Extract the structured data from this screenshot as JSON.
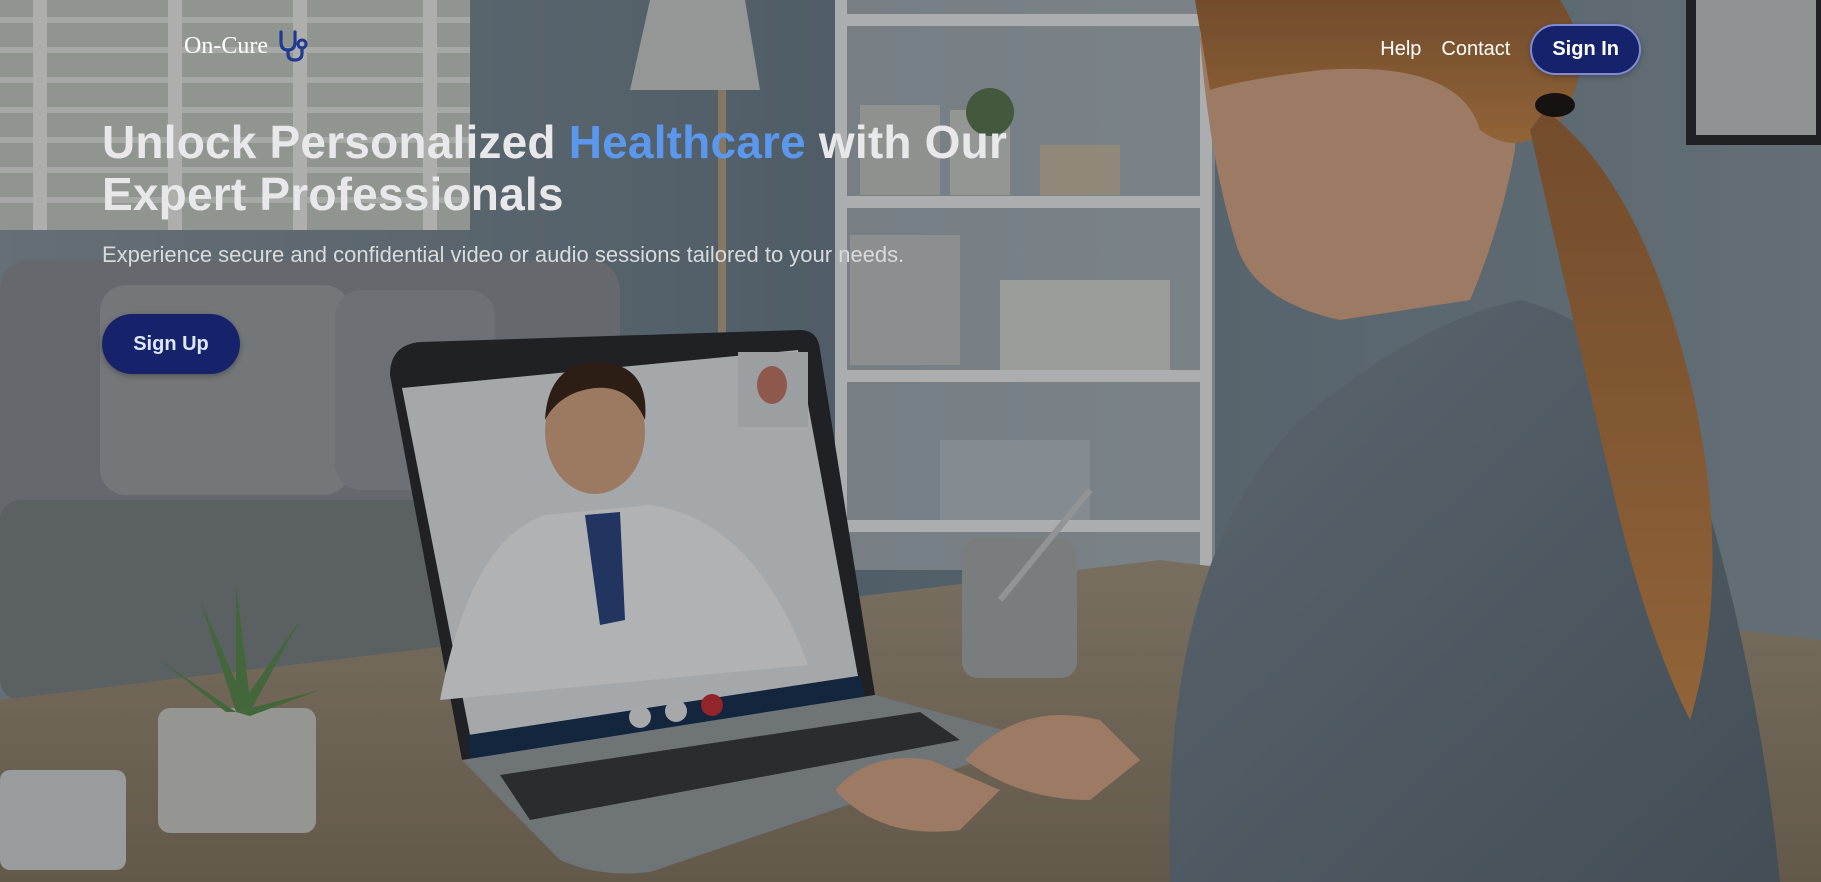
{
  "brand": {
    "name": "On-Cure",
    "icon": "stethoscope-icon"
  },
  "nav": {
    "help": "Help",
    "contact": "Contact",
    "sign_in": "Sign In"
  },
  "hero": {
    "headline_part1": "Unlock Personalized ",
    "headline_accent": "Healthcare",
    "headline_part2": " with Our Expert Professionals",
    "subtitle": "Experience secure and confidential video or audio sessions tailored to your needs.",
    "cta": "Sign Up"
  },
  "colors": {
    "accent": "#5b97ec",
    "button": "#16236b",
    "text": "#e8e8ea"
  }
}
